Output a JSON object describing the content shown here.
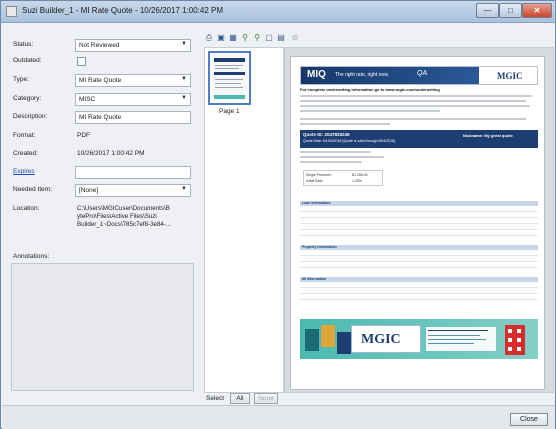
{
  "window": {
    "title": "Suzi Builder_1 - MI Rate Quote - 10/26/2017 1:00:42 PM"
  },
  "fields": {
    "status_label": "Status:",
    "status_value": "Not Reviewed",
    "outdated_label": "Outdated:",
    "type_label": "Type:",
    "type_value": "MI Rate Quote",
    "category_label": "Category:",
    "category_value": "MISC",
    "description_label": "Description:",
    "description_value": "MI Rate Quote",
    "format_label": "Format:",
    "format_value": "PDF",
    "created_label": "Created:",
    "created_value": "10/26/2017 1:00:42 PM",
    "expires_label": "Expires",
    "expires_value": "",
    "needed_item_label": "Needed Item:",
    "needed_item_value": "[None]",
    "location_label": "Location:",
    "location_value": "C:\\Users\\MGICuser\\Documents\\B ytePro\\Files\\Active Files\\Suzi Builder_1~Docs\\785c7ef8-3e84-...",
    "annotations_label": "Annotations:"
  },
  "thumbnails": {
    "page_label": "Page 1",
    "select_label": "Select",
    "all_button": "All",
    "none_button": "None"
  },
  "document": {
    "mic_text": "MIQ",
    "tagline": "The right rate, right now.",
    "qa_text": "QA",
    "logo_text": "MGIC",
    "underwriting_heading": "For complete underwriting information go to www.mgic.com/underwriting",
    "quote_id": "Quote ID: 2047826249",
    "quote_date": "Quote Date: 6/1/04/2018 (Quote is valid through 6/04/2018)",
    "nickname": "Nickname:  My great quote",
    "single_premium_label": "Single Premium:",
    "single_premium_value": "$1,158.00",
    "initial_rate_label": "Initial Rate:",
    "initial_rate_value": "1.25%",
    "loan_info_title": "Loan Information",
    "property_info_title": "Property Information",
    "mi_info_title": "MI Information",
    "ad_logo": "MGIC"
  },
  "footer": {
    "close_button": "Close"
  },
  "colors": {
    "titlebar": "#b7cbe4",
    "doc_navy": "#1d3e72",
    "ad_teal": "#4bb9b0",
    "ad_red": "#d92d2d"
  }
}
